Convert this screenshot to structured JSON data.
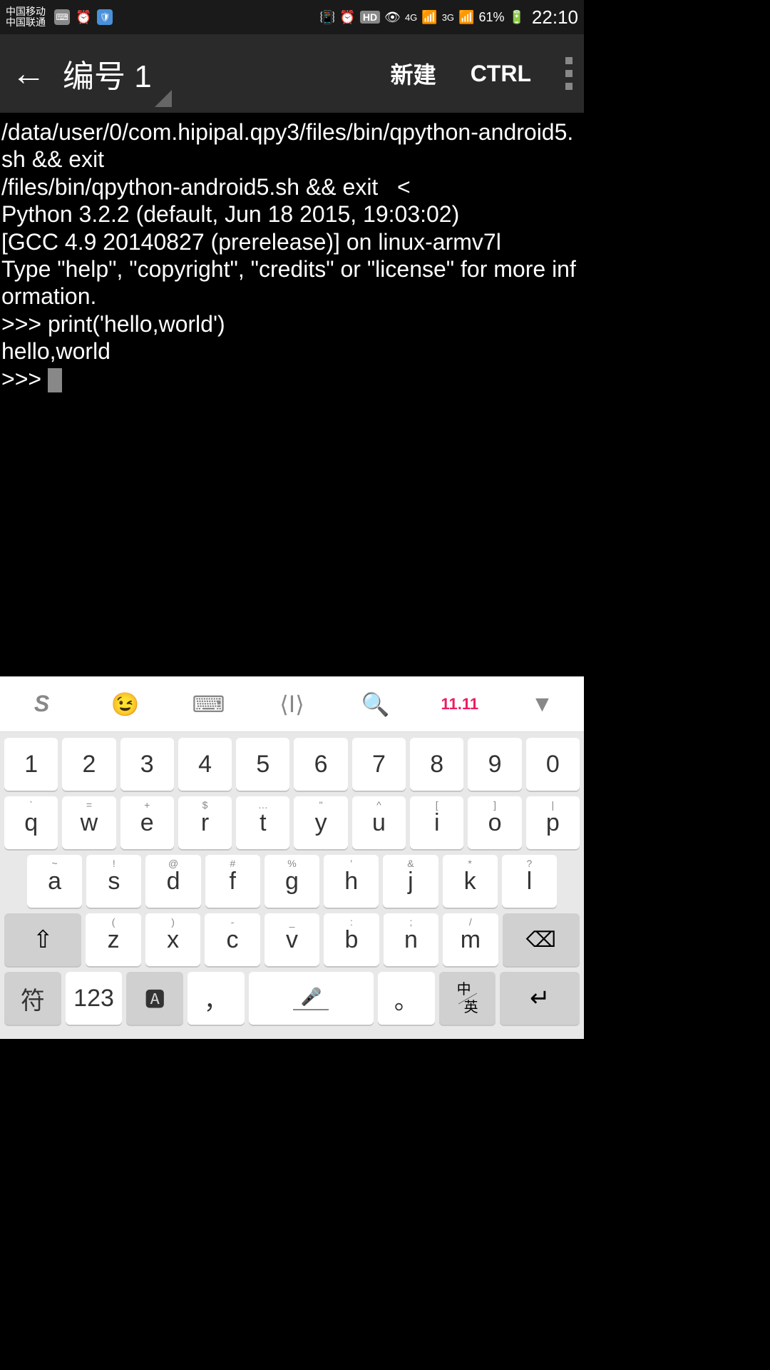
{
  "status": {
    "carrier1": "中国移动",
    "carrier2": "中国联通",
    "battery": "61%",
    "time": "22:10",
    "hd": "HD",
    "net1": "4G",
    "net2": "3G"
  },
  "appbar": {
    "title": "编号 1",
    "new_btn": "新建",
    "ctrl_btn": "CTRL"
  },
  "terminal": {
    "content": "/data/user/0/com.hipipal.qpy3/files/bin/qpython-android5.sh && exit\n/files/bin/qpython-android5.sh && exit   <\nPython 3.2.2 (default, Jun 18 2015, 19:03:02)\n[GCC 4.9 20140827 (prerelease)] on linux-armv7l\nType \"help\", \"copyright\", \"credits\" or \"license\" for more information.\n>>> print('hello,world')\nhello,world\n>>> "
  },
  "keyboard": {
    "nums": [
      "1",
      "2",
      "3",
      "4",
      "5",
      "6",
      "7",
      "8",
      "9",
      "0"
    ],
    "row1": [
      {
        "m": "q",
        "s": "`"
      },
      {
        "m": "w",
        "s": "="
      },
      {
        "m": "e",
        "s": "+"
      },
      {
        "m": "r",
        "s": "$"
      },
      {
        "m": "t",
        "s": "…"
      },
      {
        "m": "y",
        "s": "\""
      },
      {
        "m": "u",
        "s": "^"
      },
      {
        "m": "i",
        "s": "["
      },
      {
        "m": "o",
        "s": "]"
      },
      {
        "m": "p",
        "s": "|"
      }
    ],
    "row2": [
      {
        "m": "a",
        "s": "~"
      },
      {
        "m": "s",
        "s": "!"
      },
      {
        "m": "d",
        "s": "@"
      },
      {
        "m": "f",
        "s": "#"
      },
      {
        "m": "g",
        "s": "%"
      },
      {
        "m": "h",
        "s": "'"
      },
      {
        "m": "j",
        "s": "&"
      },
      {
        "m": "k",
        "s": "*"
      },
      {
        "m": "l",
        "s": "?"
      }
    ],
    "row3": [
      {
        "m": "z",
        "s": "("
      },
      {
        "m": "x",
        "s": ")"
      },
      {
        "m": "c",
        "s": "-"
      },
      {
        "m": "v",
        "s": "_"
      },
      {
        "m": "b",
        "s": ":"
      },
      {
        "m": "n",
        "s": ";"
      },
      {
        "m": "m",
        "s": "/"
      }
    ],
    "fn": {
      "sym": "符",
      "num": "123",
      "comma": "，",
      "period": "。",
      "cn": "中",
      "en": "英"
    },
    "promo": "11.11"
  }
}
